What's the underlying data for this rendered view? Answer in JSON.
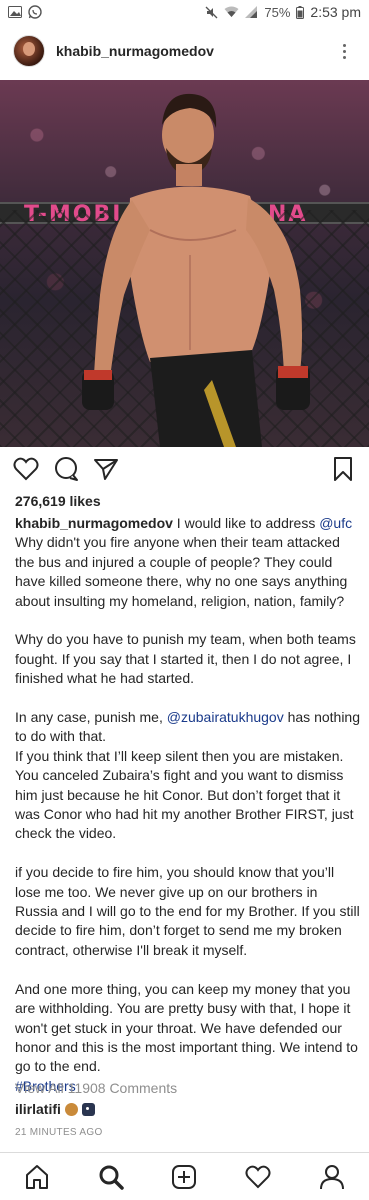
{
  "status_bar": {
    "battery": "75%",
    "time": "2:53 pm",
    "icons": [
      "gallery-icon",
      "whatsapp-icon",
      "mute-icon",
      "wifi-icon",
      "signal-icon",
      "battery-icon"
    ]
  },
  "post": {
    "username": "khabib_nurmagomedov",
    "photo_banner_left": "T-MOBI",
    "photo_banner_right": "NA",
    "likes": "276,619 likes",
    "caption": {
      "username": "khabib_nurmagomedov",
      "p1_a": " I would like to address ",
      "p1_mention": "@ufc",
      "p1_b": " Why didn't you fire anyone when their team attacked the bus and injured a couple of people? They could have killed someone there, why no one says anything about insulting my homeland, religion, nation, family?",
      "p2": "Why do you have to punish my team, when both teams fought. If you say that I started it, then I do not agree, I finished what he had started.",
      "p3_a": "In any case, punish me, ",
      "p3_mention": "@zubairatukhugov",
      "p3_b": " has nothing to do with that.",
      "p4": "If you think that I’ll keep silent then you are mistaken. You canceled Zubaira’s fight and you want to dismiss him just because he hit Conor. But don’t forget that it was Conor who had hit my another Brother FIRST, just check the video.",
      "p5": "if you decide to fire him, you should know that you’ll lose me too. We never give up on our brothers in Russia and I will go to the end for my Brother. If you still decide to fire him, don’t forget to send me my broken contract, otherwise I'll break it myself.",
      "p6": "And one more thing, you can keep my money that you are withholding. You are pretty busy with that, I hope it won't get stuck in your throat. We have defended our honor and this is the most important thing. We intend to go to the end.",
      "hashtag": "#Brothers"
    },
    "view_comments": "View All 11908 Comments",
    "comment": {
      "username": "ilirlatifi"
    },
    "timestamp": "21 MINUTES AGO"
  },
  "colors": {
    "link": "#1a3a8a",
    "muted": "#8e8e8e",
    "text": "#262626",
    "banner_text": "#e24b8c"
  },
  "bottom_nav": [
    "home-icon",
    "search-icon",
    "new-post-icon",
    "activity-heart-icon",
    "profile-icon"
  ]
}
